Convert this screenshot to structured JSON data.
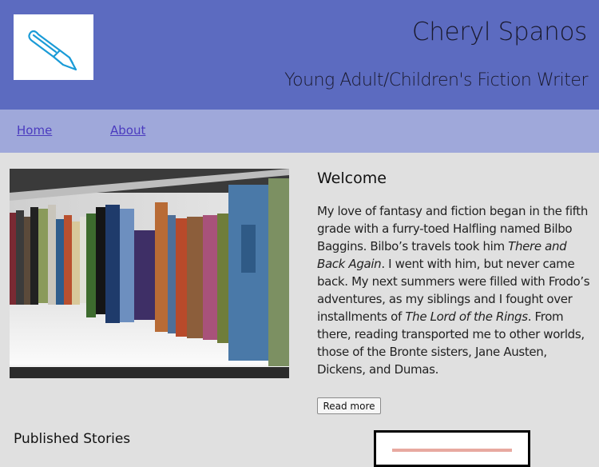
{
  "header": {
    "title": "Cheryl Spanos",
    "subtitle": "Young Adult/Children's Fiction Writer",
    "logo_icon": "fountain-pen-icon",
    "background_color": "#5c6bc0"
  },
  "nav": {
    "items": [
      {
        "label": "Home"
      },
      {
        "label": "About"
      }
    ],
    "background_color": "#9fa8da"
  },
  "welcome": {
    "heading": "Welcome",
    "text_1": "My love of fantasy and fiction began in the fifth grade with a furry-toed Halfling named Bilbo Baggins. Bilbo’s travels took him ",
    "italic_1": "There and Back Again",
    "text_2": ". I went with him, but never came back. My next summers were filled with Frodo’s adventures, as my siblings and I fought over installments of ",
    "italic_2": "The Lord of the Rings",
    "text_3": ". From there, reading transported me to other worlds, those of the Bronte sisters, Jane Austen, Dickens, and Dumas.",
    "read_more_label": "Read more"
  },
  "published": {
    "heading": "Published Stories"
  }
}
